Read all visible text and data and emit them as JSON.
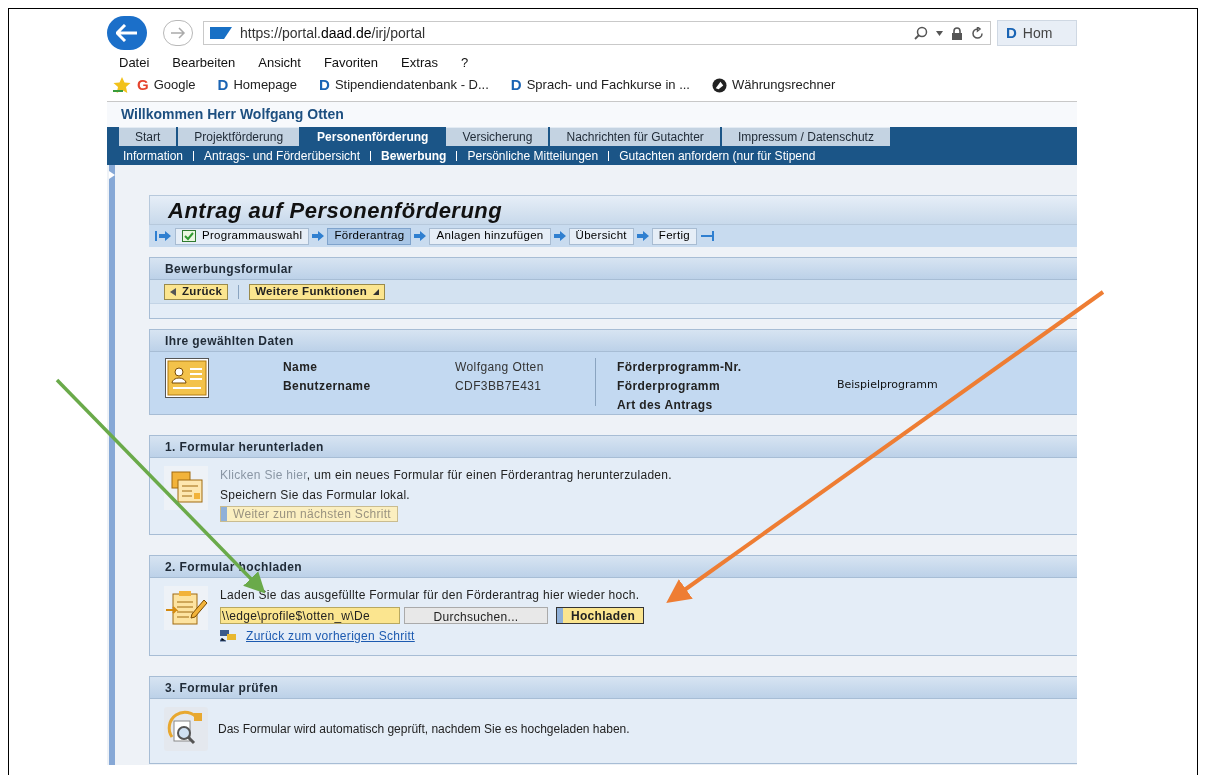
{
  "browser": {
    "address_prefix": "https://portal.",
    "address_host": "daad.de",
    "address_path": "/irj/portal",
    "tab": "Hom",
    "tab_icon": "D",
    "menu": [
      "Datei",
      "Bearbeiten",
      "Ansicht",
      "Favoriten",
      "Extras",
      "?"
    ],
    "favorites": [
      {
        "kind": "google",
        "icon": "G",
        "label": "Google"
      },
      {
        "kind": "daad",
        "icon": "D",
        "label": "Homepage"
      },
      {
        "kind": "daad",
        "icon": "D",
        "label": "Stipendiendatenbank - D..."
      },
      {
        "kind": "daad",
        "icon": "D",
        "label": "Sprach- und Fachkurse in ..."
      },
      {
        "kind": "round",
        "label": "Währungsrechner"
      }
    ]
  },
  "portal": {
    "welcome": "Willkommen Herr Wolfgang Otten",
    "tabs": [
      {
        "label": "Start",
        "selected": false
      },
      {
        "label": "Projektförderung",
        "selected": false
      },
      {
        "label": "Personenförderung",
        "selected": true
      },
      {
        "label": "Versicherung",
        "selected": false
      },
      {
        "label": "Nachrichten für Gutachter",
        "selected": false
      },
      {
        "label": "Impressum / Datenschutz",
        "selected": false
      }
    ],
    "subnav": [
      {
        "label": "Information",
        "selected": false
      },
      {
        "label": "Antrags- und Förderübersicht",
        "selected": false
      },
      {
        "label": "Bewerbung",
        "selected": true
      },
      {
        "label": "Persönliche Mitteilungen",
        "selected": false
      },
      {
        "label": "Gutachten anfordern (nur für Stipend",
        "selected": false
      }
    ]
  },
  "page_title": "Antrag auf Personenförderung",
  "roadmap": [
    {
      "label": "Programmauswahl",
      "selected": false,
      "completed": true
    },
    {
      "label": "Förderantrag",
      "selected": true,
      "completed": false
    },
    {
      "label": "Anlagen hinzufügen",
      "selected": false,
      "completed": false
    },
    {
      "label": "Übersicht",
      "selected": false,
      "completed": false
    },
    {
      "label": "Fertig",
      "selected": false,
      "completed": false
    }
  ],
  "form_panel": {
    "title": "Bewerbungsformular",
    "buttons": [
      {
        "kind": "back",
        "label": "Zurück"
      },
      {
        "kind": "menu",
        "label": "Weitere Funktionen"
      }
    ]
  },
  "data_panel": {
    "title": "Ihre gewählten Daten",
    "left": [
      {
        "label": "Name",
        "value": "Wolfgang Otten"
      },
      {
        "label": "Benutzername",
        "value": "CDF3BB7E431"
      }
    ],
    "right": [
      {
        "label": "Förderprogramm-Nr."
      },
      {
        "label": "Förderprogramm",
        "value": "Beispielprogramm"
      },
      {
        "label": "Art des Antrags"
      }
    ]
  },
  "download": {
    "title": "1. Formular herunterladen",
    "link": {
      "label": "Klicken Sie hier",
      "disabled": true
    },
    "sentence_rest": ", um ein neues Formular für einen Förderantrag herunterzuladen.",
    "note": "Speichern Sie das Formular lokal.",
    "button": {
      "label": "Weiter zum nächsten Schritt",
      "disabled": true
    }
  },
  "upload": {
    "title": "2. Formular hochladen",
    "text": "Laden Sie das ausgefüllte Formular für den Förderantrag hier wieder hoch.",
    "file_value": "\\\\edge\\profile$\\otten_w\\De",
    "browse": "Durchsuchen...",
    "upload": "Hochladen",
    "back_link": "Zurück zum vorherigen Schritt"
  },
  "check": {
    "title": "3. Formular prüfen",
    "text": "Das Formular wird automatisch geprüft, nachdem Sie es hochgeladen haben."
  }
}
